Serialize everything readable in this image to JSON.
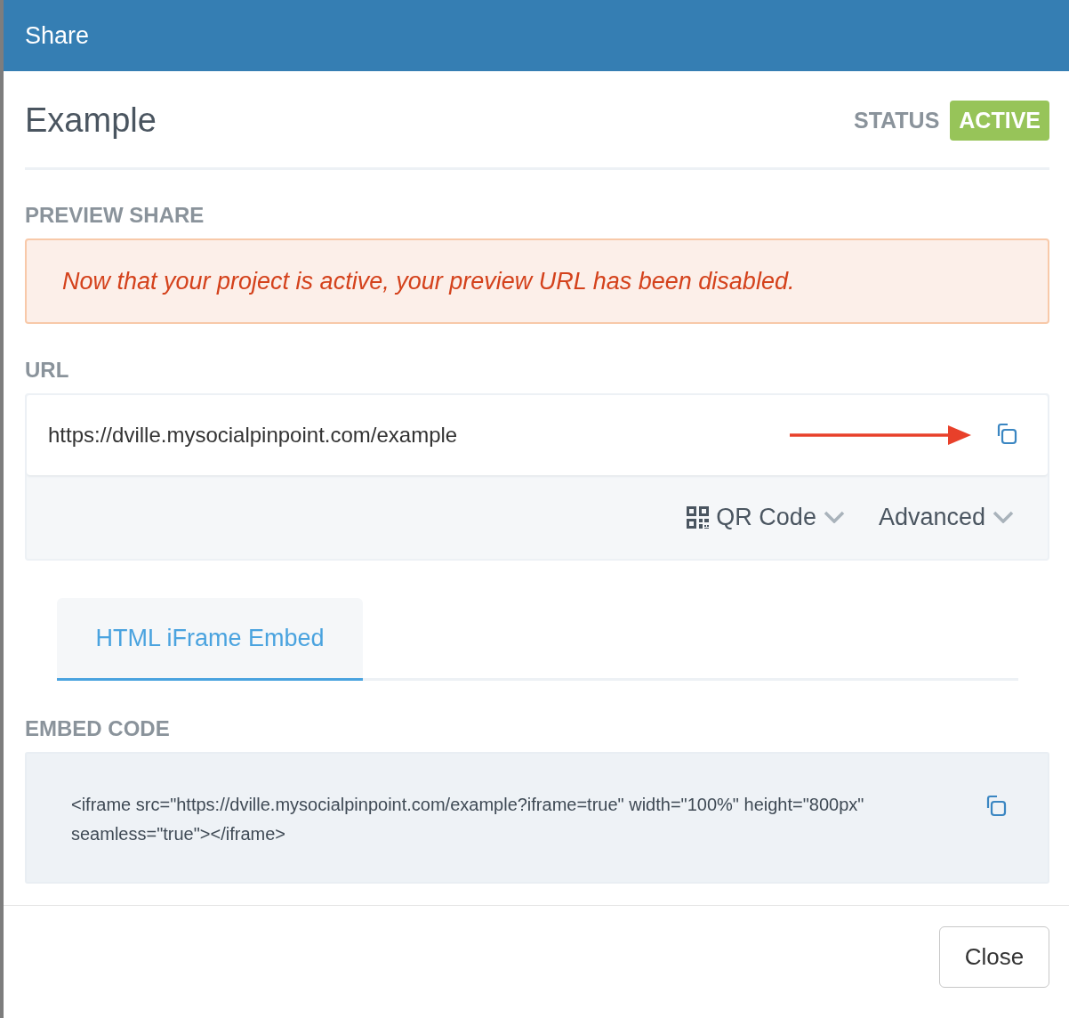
{
  "dialog": {
    "title": "Share"
  },
  "project": {
    "name": "Example",
    "status_label": "STATUS",
    "status": "ACTIVE"
  },
  "preview": {
    "heading": "PREVIEW SHARE",
    "message": "Now that your project is active, your preview URL has been disabled."
  },
  "url": {
    "heading": "URL",
    "value": "https://dville.mysocialpinpoint.com/example",
    "options": [
      {
        "kind": "qr",
        "label": "QR Code",
        "expanded": false
      },
      {
        "kind": "plain",
        "label": "Advanced",
        "expanded": false
      }
    ]
  },
  "tabs": [
    {
      "label": "HTML iFrame Embed",
      "selected": true
    }
  ],
  "embed": {
    "heading": "EMBED CODE",
    "code": "<iframe src=\"https://dville.mysocialpinpoint.com/example?iframe=true\" width=\"100%\" height=\"800px\" seamless=\"true\"></iframe>"
  },
  "footer": {
    "buttons": [
      "Close"
    ]
  }
}
